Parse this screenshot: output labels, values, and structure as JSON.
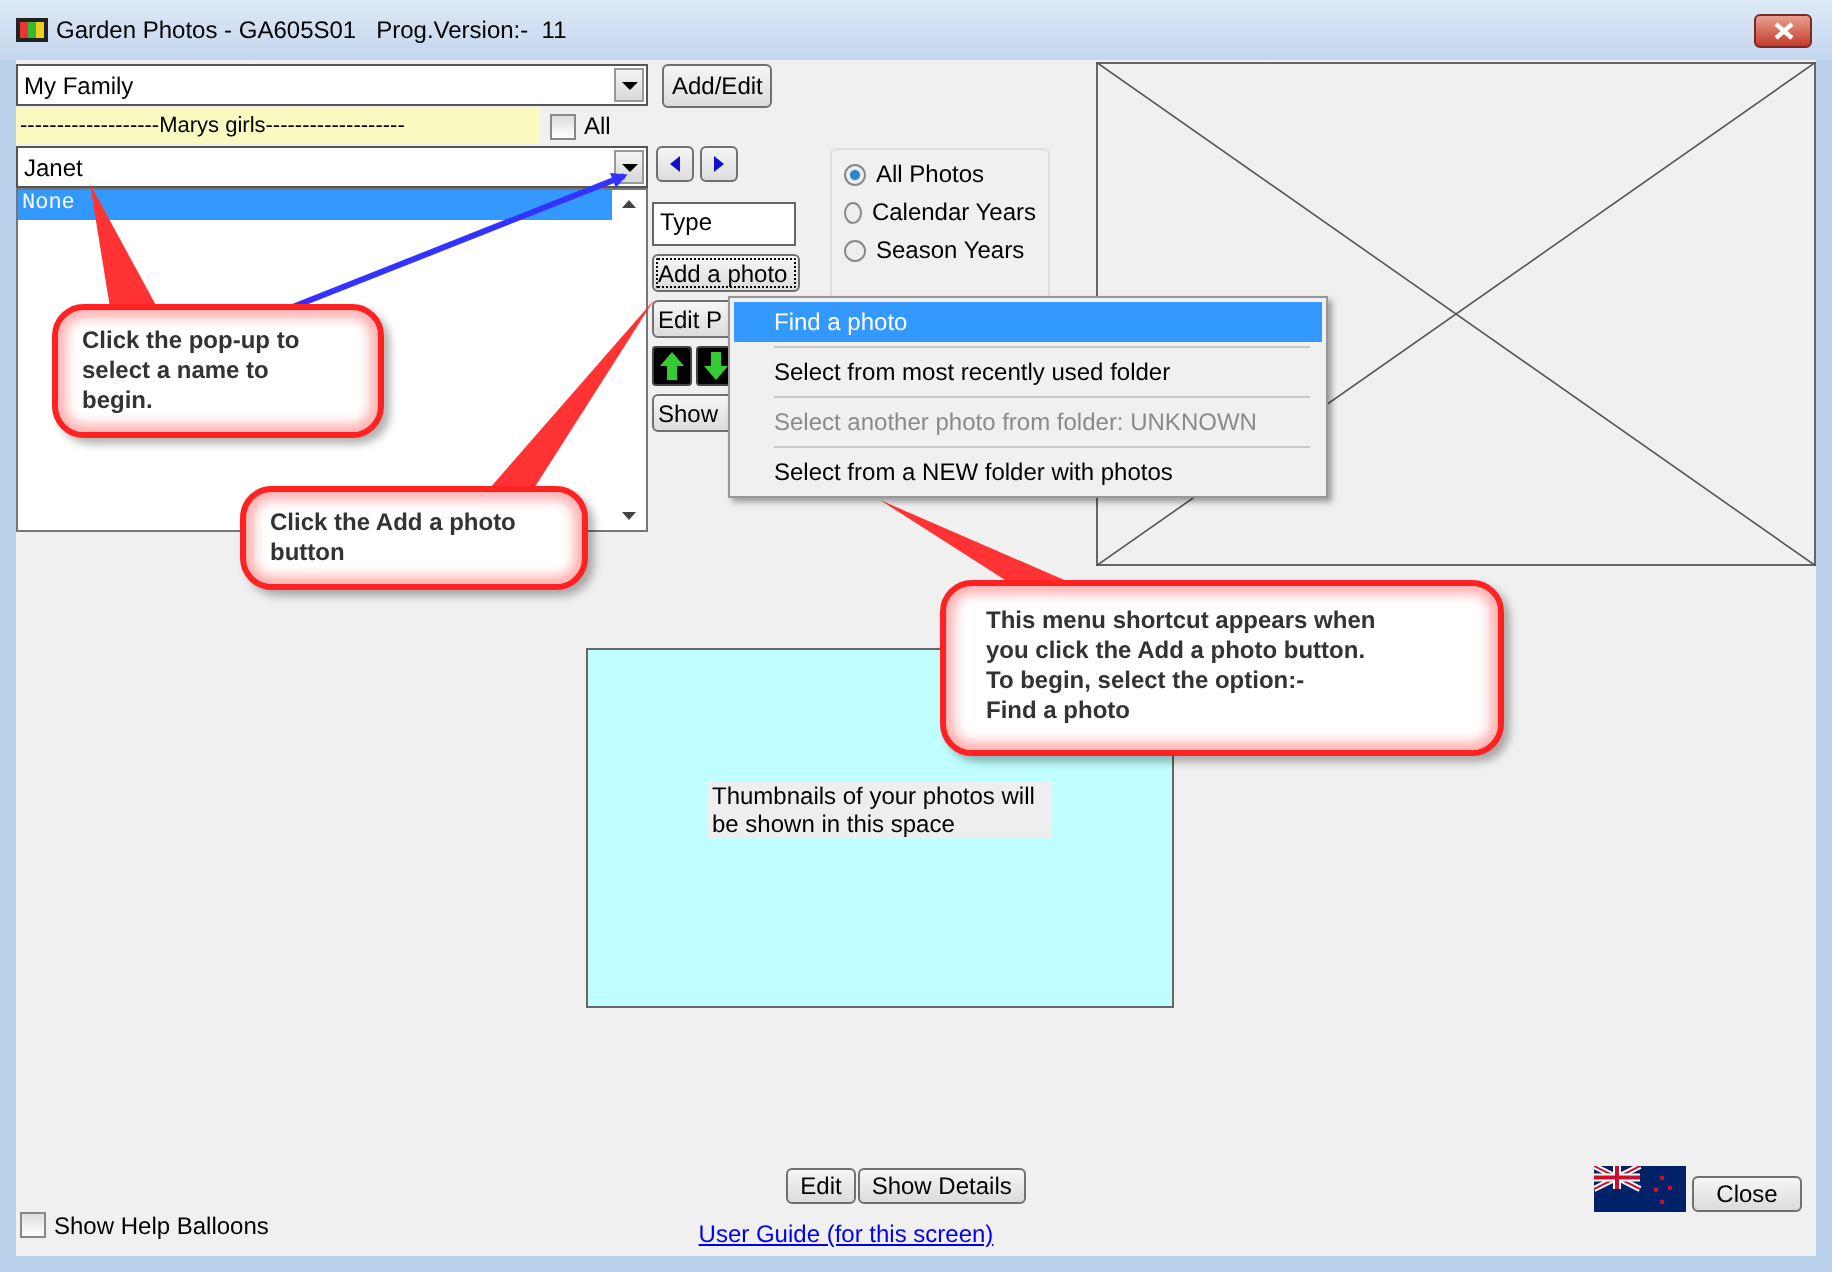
{
  "window": {
    "title": "Garden Photos - GA605S01   Prog.Version:-  11"
  },
  "group_select": {
    "value": "My Family"
  },
  "add_edit_button": "Add/Edit",
  "group_label": "-------------------Marys girls-------------------",
  "all_checkbox": {
    "label": "All",
    "checked": false
  },
  "person_select": {
    "value": "Janet"
  },
  "name_list": [
    {
      "label": "None",
      "selected": true
    }
  ],
  "type_field": {
    "value": "Type"
  },
  "side_buttons": [
    {
      "label": "Add a photo",
      "focused": true
    },
    {
      "label": "Edit P",
      "focused": false
    }
  ],
  "show_button": "Show",
  "radios": [
    {
      "label": "All Photos",
      "selected": true
    },
    {
      "label": "Calendar Years",
      "selected": false
    },
    {
      "label": "Season Years",
      "selected": false
    }
  ],
  "context_menu": [
    {
      "label": "Find a photo",
      "highlighted": true,
      "disabled": false
    },
    {
      "label": "Select from most recently used folder",
      "highlighted": false,
      "disabled": false
    },
    {
      "label": "Select another photo from folder: UNKNOWN",
      "highlighted": false,
      "disabled": true
    },
    {
      "label": "Select from a NEW folder with photos",
      "highlighted": false,
      "disabled": false
    }
  ],
  "thumbnail_hint": "Thumbnails of your photos will be shown in this space",
  "bottom_buttons": [
    "Edit",
    "Show Details"
  ],
  "close_button": "Close",
  "help_balloons": {
    "label": "Show Help Balloons",
    "checked": false
  },
  "user_guide_link": "User Guide (for this screen)",
  "callouts": [
    "Click the pop-up to\nselect a name to\nbegin.",
    "Click the Add a photo\nbutton",
    "This menu shortcut appears when\nyou click the Add a photo button.\nTo begin, select the option:-\nFind a photo"
  ]
}
